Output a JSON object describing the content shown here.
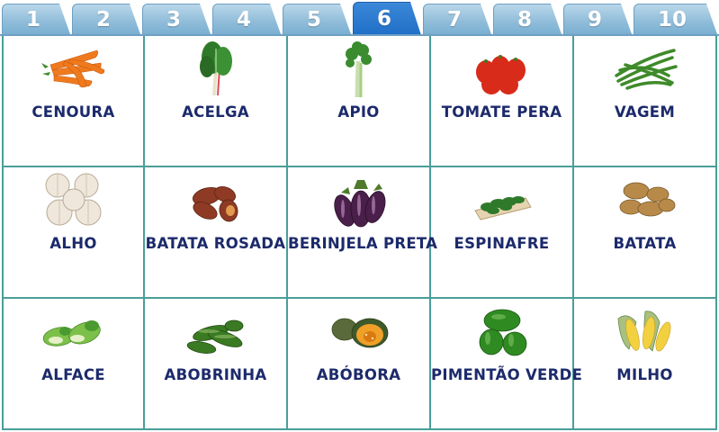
{
  "tabs": [
    "1",
    "2",
    "3",
    "4",
    "5",
    "6",
    "7",
    "8",
    "9",
    "10"
  ],
  "active_tab": "6",
  "colors": {
    "tab": "#8fbcd9",
    "tab_active": "#1f6fc7",
    "grid_line": "#4a9e9a",
    "label": "#1c2a6b"
  },
  "items": [
    {
      "label": "CENOURA",
      "icon": "carrot-icon"
    },
    {
      "label": "ACELGA",
      "icon": "chard-icon"
    },
    {
      "label": "APIO",
      "icon": "celery-icon"
    },
    {
      "label": "TOMATE PERA",
      "icon": "tomato-icon"
    },
    {
      "label": "VAGEM",
      "icon": "green-bean-icon"
    },
    {
      "label": "ALHO",
      "icon": "garlic-icon"
    },
    {
      "label": "BATATA ROSADA",
      "icon": "sweet-potato-icon"
    },
    {
      "label": "BERINJELA PRETA",
      "icon": "eggplant-icon"
    },
    {
      "label": "ESPINAFRE",
      "icon": "spinach-icon"
    },
    {
      "label": "BATATA",
      "icon": "potato-icon"
    },
    {
      "label": "ALFACE",
      "icon": "lettuce-icon"
    },
    {
      "label": "ABOBRINHA",
      "icon": "zucchini-icon"
    },
    {
      "label": "ABÓBORA",
      "icon": "pumpkin-icon"
    },
    {
      "label": "PIMENTÃO VERDE",
      "icon": "green-pepper-icon"
    },
    {
      "label": "MILHO",
      "icon": "corn-icon"
    }
  ]
}
